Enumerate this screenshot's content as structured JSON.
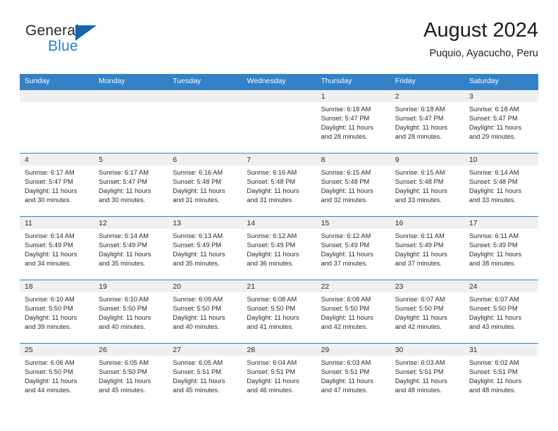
{
  "brand": {
    "name_primary": "General",
    "name_secondary": "Blue",
    "triangle_icon": "blue-triangle-logo-mark",
    "accent_color": "#1664ac",
    "secondary_color": "#2a7fc9"
  },
  "header": {
    "title": "August 2024",
    "subtitle": "Puquio, Ayacucho, Peru"
  },
  "theme": {
    "header_row_bg": "#3581c6",
    "header_row_text": "#ffffff",
    "daynum_band_bg": "#f0f0f0",
    "cell_bg": "#ffffff",
    "grid_line": "#3581c6"
  },
  "weekdays": [
    "Sunday",
    "Monday",
    "Tuesday",
    "Wednesday",
    "Thursday",
    "Friday",
    "Saturday"
  ],
  "labels": {
    "sunrise_prefix": "Sunrise: ",
    "sunset_prefix": "Sunset: ",
    "daylight_prefix": "Daylight: "
  },
  "weeks": [
    [
      {
        "empty": true
      },
      {
        "empty": true
      },
      {
        "empty": true
      },
      {
        "empty": true
      },
      {
        "day": "1",
        "sunrise": "Sunrise: 6:18 AM",
        "sunset": "Sunset: 5:47 PM",
        "daylight_line1": "Daylight: 11 hours",
        "daylight_line2": "and 28 minutes."
      },
      {
        "day": "2",
        "sunrise": "Sunrise: 6:18 AM",
        "sunset": "Sunset: 5:47 PM",
        "daylight_line1": "Daylight: 11 hours",
        "daylight_line2": "and 28 minutes."
      },
      {
        "day": "3",
        "sunrise": "Sunrise: 6:18 AM",
        "sunset": "Sunset: 5:47 PM",
        "daylight_line1": "Daylight: 11 hours",
        "daylight_line2": "and 29 minutes."
      }
    ],
    [
      {
        "day": "4",
        "sunrise": "Sunrise: 6:17 AM",
        "sunset": "Sunset: 5:47 PM",
        "daylight_line1": "Daylight: 11 hours",
        "daylight_line2": "and 30 minutes."
      },
      {
        "day": "5",
        "sunrise": "Sunrise: 6:17 AM",
        "sunset": "Sunset: 5:47 PM",
        "daylight_line1": "Daylight: 11 hours",
        "daylight_line2": "and 30 minutes."
      },
      {
        "day": "6",
        "sunrise": "Sunrise: 6:16 AM",
        "sunset": "Sunset: 5:48 PM",
        "daylight_line1": "Daylight: 11 hours",
        "daylight_line2": "and 31 minutes."
      },
      {
        "day": "7",
        "sunrise": "Sunrise: 6:16 AM",
        "sunset": "Sunset: 5:48 PM",
        "daylight_line1": "Daylight: 11 hours",
        "daylight_line2": "and 31 minutes."
      },
      {
        "day": "8",
        "sunrise": "Sunrise: 6:15 AM",
        "sunset": "Sunset: 5:48 PM",
        "daylight_line1": "Daylight: 11 hours",
        "daylight_line2": "and 32 minutes."
      },
      {
        "day": "9",
        "sunrise": "Sunrise: 6:15 AM",
        "sunset": "Sunset: 5:48 PM",
        "daylight_line1": "Daylight: 11 hours",
        "daylight_line2": "and 33 minutes."
      },
      {
        "day": "10",
        "sunrise": "Sunrise: 6:14 AM",
        "sunset": "Sunset: 5:48 PM",
        "daylight_line1": "Daylight: 11 hours",
        "daylight_line2": "and 33 minutes."
      }
    ],
    [
      {
        "day": "11",
        "sunrise": "Sunrise: 6:14 AM",
        "sunset": "Sunset: 5:49 PM",
        "daylight_line1": "Daylight: 11 hours",
        "daylight_line2": "and 34 minutes."
      },
      {
        "day": "12",
        "sunrise": "Sunrise: 6:14 AM",
        "sunset": "Sunset: 5:49 PM",
        "daylight_line1": "Daylight: 11 hours",
        "daylight_line2": "and 35 minutes."
      },
      {
        "day": "13",
        "sunrise": "Sunrise: 6:13 AM",
        "sunset": "Sunset: 5:49 PM",
        "daylight_line1": "Daylight: 11 hours",
        "daylight_line2": "and 35 minutes."
      },
      {
        "day": "14",
        "sunrise": "Sunrise: 6:12 AM",
        "sunset": "Sunset: 5:49 PM",
        "daylight_line1": "Daylight: 11 hours",
        "daylight_line2": "and 36 minutes."
      },
      {
        "day": "15",
        "sunrise": "Sunrise: 6:12 AM",
        "sunset": "Sunset: 5:49 PM",
        "daylight_line1": "Daylight: 11 hours",
        "daylight_line2": "and 37 minutes."
      },
      {
        "day": "16",
        "sunrise": "Sunrise: 6:11 AM",
        "sunset": "Sunset: 5:49 PM",
        "daylight_line1": "Daylight: 11 hours",
        "daylight_line2": "and 37 minutes."
      },
      {
        "day": "17",
        "sunrise": "Sunrise: 6:11 AM",
        "sunset": "Sunset: 5:49 PM",
        "daylight_line1": "Daylight: 11 hours",
        "daylight_line2": "and 38 minutes."
      }
    ],
    [
      {
        "day": "18",
        "sunrise": "Sunrise: 6:10 AM",
        "sunset": "Sunset: 5:50 PM",
        "daylight_line1": "Daylight: 11 hours",
        "daylight_line2": "and 39 minutes."
      },
      {
        "day": "19",
        "sunrise": "Sunrise: 6:10 AM",
        "sunset": "Sunset: 5:50 PM",
        "daylight_line1": "Daylight: 11 hours",
        "daylight_line2": "and 40 minutes."
      },
      {
        "day": "20",
        "sunrise": "Sunrise: 6:09 AM",
        "sunset": "Sunset: 5:50 PM",
        "daylight_line1": "Daylight: 11 hours",
        "daylight_line2": "and 40 minutes."
      },
      {
        "day": "21",
        "sunrise": "Sunrise: 6:08 AM",
        "sunset": "Sunset: 5:50 PM",
        "daylight_line1": "Daylight: 11 hours",
        "daylight_line2": "and 41 minutes."
      },
      {
        "day": "22",
        "sunrise": "Sunrise: 6:08 AM",
        "sunset": "Sunset: 5:50 PM",
        "daylight_line1": "Daylight: 11 hours",
        "daylight_line2": "and 42 minutes."
      },
      {
        "day": "23",
        "sunrise": "Sunrise: 6:07 AM",
        "sunset": "Sunset: 5:50 PM",
        "daylight_line1": "Daylight: 11 hours",
        "daylight_line2": "and 42 minutes."
      },
      {
        "day": "24",
        "sunrise": "Sunrise: 6:07 AM",
        "sunset": "Sunset: 5:50 PM",
        "daylight_line1": "Daylight: 11 hours",
        "daylight_line2": "and 43 minutes."
      }
    ],
    [
      {
        "day": "25",
        "sunrise": "Sunrise: 6:06 AM",
        "sunset": "Sunset: 5:50 PM",
        "daylight_line1": "Daylight: 11 hours",
        "daylight_line2": "and 44 minutes."
      },
      {
        "day": "26",
        "sunrise": "Sunrise: 6:05 AM",
        "sunset": "Sunset: 5:50 PM",
        "daylight_line1": "Daylight: 11 hours",
        "daylight_line2": "and 45 minutes."
      },
      {
        "day": "27",
        "sunrise": "Sunrise: 6:05 AM",
        "sunset": "Sunset: 5:51 PM",
        "daylight_line1": "Daylight: 11 hours",
        "daylight_line2": "and 45 minutes."
      },
      {
        "day": "28",
        "sunrise": "Sunrise: 6:04 AM",
        "sunset": "Sunset: 5:51 PM",
        "daylight_line1": "Daylight: 11 hours",
        "daylight_line2": "and 46 minutes."
      },
      {
        "day": "29",
        "sunrise": "Sunrise: 6:03 AM",
        "sunset": "Sunset: 5:51 PM",
        "daylight_line1": "Daylight: 11 hours",
        "daylight_line2": "and 47 minutes."
      },
      {
        "day": "30",
        "sunrise": "Sunrise: 6:03 AM",
        "sunset": "Sunset: 5:51 PM",
        "daylight_line1": "Daylight: 11 hours",
        "daylight_line2": "and 48 minutes."
      },
      {
        "day": "31",
        "sunrise": "Sunrise: 6:02 AM",
        "sunset": "Sunset: 5:51 PM",
        "daylight_line1": "Daylight: 11 hours",
        "daylight_line2": "and 48 minutes."
      }
    ]
  ]
}
